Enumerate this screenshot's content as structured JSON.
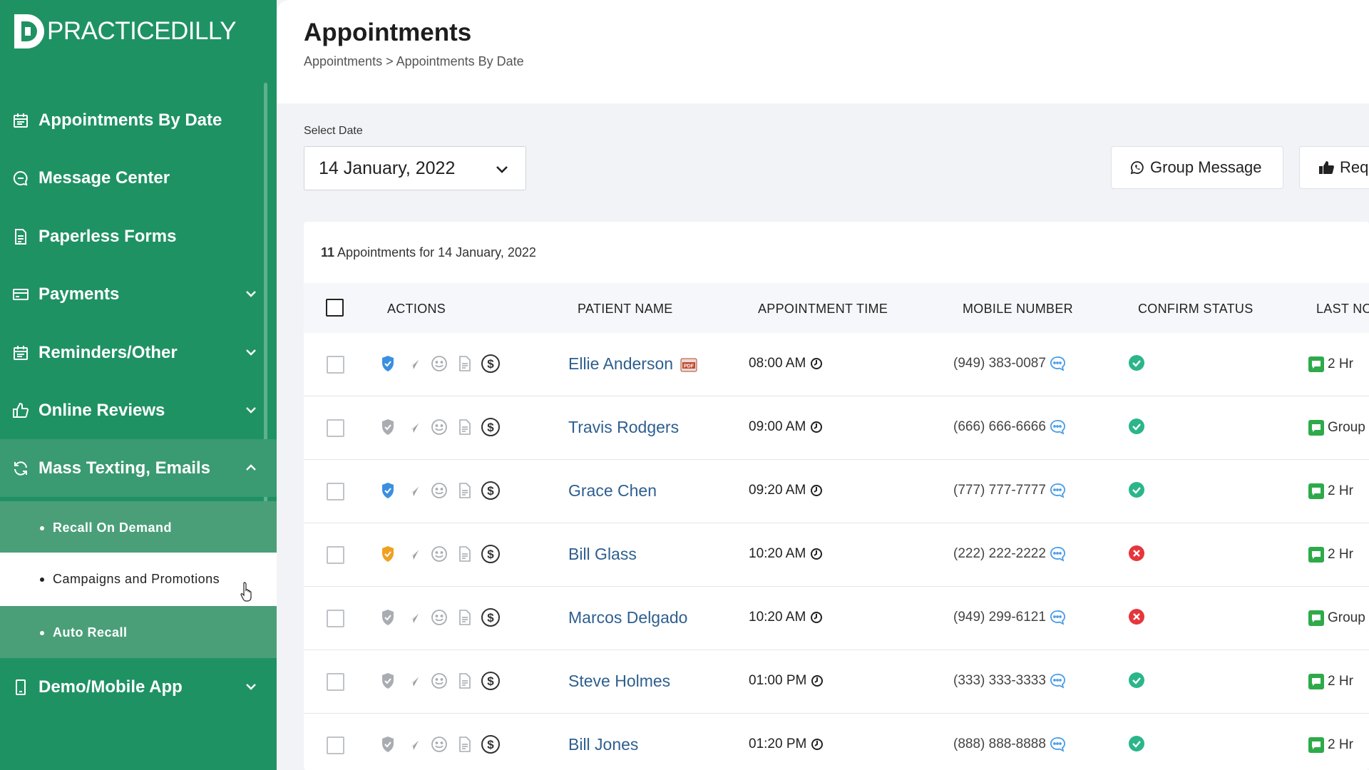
{
  "app": {
    "brand": "PRACTICEDILLY",
    "colors": {
      "sidebar": "#1f9264",
      "link": "#2e5f8f",
      "confirm_ok": "#2bb58a",
      "confirm_no": "#e5363c",
      "shield_blue": "#3b8fe0",
      "shield_orange": "#f0a020"
    }
  },
  "sidebar": {
    "items": [
      {
        "label": "Appointments By Date",
        "icon": "calendar-icon"
      },
      {
        "label": "Message Center",
        "icon": "chat-icon"
      },
      {
        "label": "Paperless Forms",
        "icon": "document-icon"
      },
      {
        "label": "Payments",
        "icon": "card-icon",
        "expandable": true
      },
      {
        "label": "Reminders/Other",
        "icon": "calendar-icon",
        "expandable": true
      },
      {
        "label": "Online Reviews",
        "icon": "thumbs-up-icon",
        "expandable": true
      },
      {
        "label": "Mass Texting, Emails",
        "icon": "refresh-icon",
        "expanded": true
      },
      {
        "label": "Demo/Mobile App",
        "icon": "mobile-icon",
        "expandable": true
      }
    ],
    "subitems": [
      {
        "label": "Recall On Demand"
      },
      {
        "label": "Campaigns and Promotions",
        "active": true
      },
      {
        "label": "Auto Recall"
      }
    ]
  },
  "header": {
    "title": "Appointments",
    "breadcrumb": "Appointments > Appointments By Date"
  },
  "filters": {
    "date_label": "Select Date",
    "date_value": "14 January, 2022"
  },
  "buttons": {
    "group_message": "Group Message",
    "request_partial": "Req"
  },
  "summary": {
    "count": "11",
    "text": "Appointments for 14 January, 2022"
  },
  "table": {
    "columns": [
      "ACTIONS",
      "PATIENT NAME",
      "APPOINTMENT TIME",
      "MOBILE NUMBER",
      "CONFIRM STATUS",
      "LAST NO"
    ],
    "rows": [
      {
        "name": "Ellie Anderson",
        "pdf": true,
        "time": "08:00 AM",
        "phone": "(949) 383-0087",
        "confirmed": true,
        "shield": "blue",
        "last": "2 Hr"
      },
      {
        "name": "Travis Rodgers",
        "pdf": false,
        "time": "09:00 AM",
        "phone": "(666) 666-6666",
        "confirmed": true,
        "shield": "gray",
        "last": "Group"
      },
      {
        "name": "Grace Chen",
        "pdf": false,
        "time": "09:20 AM",
        "phone": "(777) 777-7777",
        "confirmed": true,
        "shield": "blue",
        "last": "2 Hr"
      },
      {
        "name": "Bill Glass",
        "pdf": false,
        "time": "10:20 AM",
        "phone": "(222) 222-2222",
        "confirmed": false,
        "shield": "orange",
        "last": "2 Hr"
      },
      {
        "name": "Marcos Delgado",
        "pdf": false,
        "time": "10:20 AM",
        "phone": "(949) 299-6121",
        "confirmed": false,
        "shield": "gray",
        "last": "Group"
      },
      {
        "name": "Steve Holmes",
        "pdf": false,
        "time": "01:00 PM",
        "phone": "(333) 333-3333",
        "confirmed": true,
        "shield": "gray",
        "last": "2 Hr"
      },
      {
        "name": "Bill Jones",
        "pdf": false,
        "time": "01:20 PM",
        "phone": "(888) 888-8888",
        "confirmed": true,
        "shield": "gray",
        "last": "2 Hr"
      }
    ]
  }
}
